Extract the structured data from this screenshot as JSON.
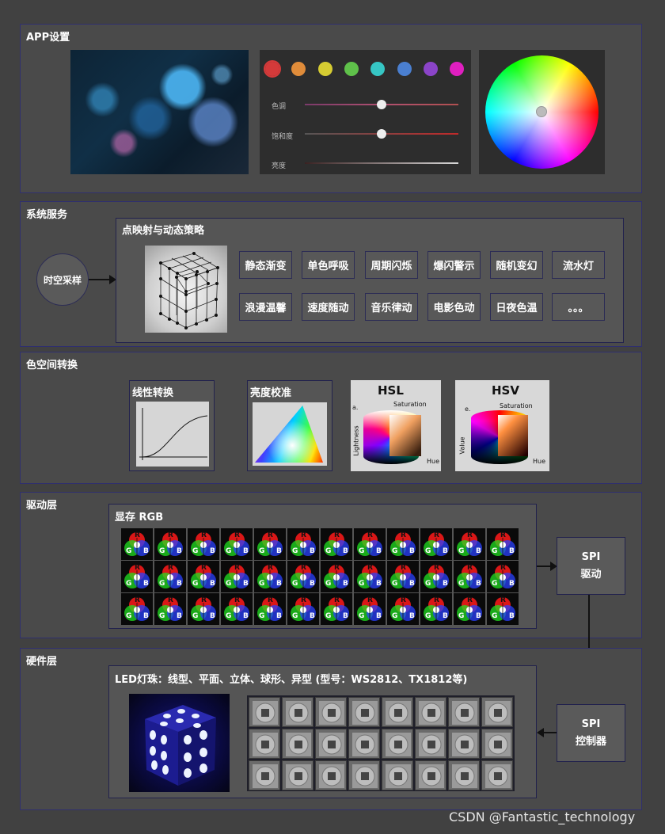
{
  "sections": {
    "app": "APP设置",
    "system": "系统服务",
    "color_space": "色空间转换",
    "driver": "驱动层",
    "hardware": "硬件层"
  },
  "app": {
    "swatches": [
      "#d43a3a",
      "#e08c3a",
      "#d6cc32",
      "#5fc14a",
      "#36c6c4",
      "#4a7fd0",
      "#8b44c8",
      "#e01fc0"
    ],
    "sliders": [
      {
        "label": "色调",
        "value": 0.5
      },
      {
        "label": "饱和度",
        "value": 0.5
      },
      {
        "label": "亮度",
        "value": 1.0
      }
    ]
  },
  "system": {
    "sampling": "时空采样",
    "strategy_title": "点映射与动态策略",
    "effects": [
      "静态渐变",
      "单色呼吸",
      "周期闪烁",
      "爆闪警示",
      "随机变幻",
      "流水灯",
      "浪漫温馨",
      "速度随动",
      "音乐律动",
      "电影色动",
      "日夜色温",
      "。。。"
    ]
  },
  "color_space": {
    "linear": "线性转换",
    "brightness": "亮度校准",
    "hsl_title": "HSL",
    "hsv_title": "HSV",
    "hsl_labels": {
      "panel": "a.",
      "saturation": "Saturation",
      "lightness": "Lightness",
      "hue": "Hue"
    },
    "hsv_labels": {
      "panel": "e.",
      "saturation": "Saturation",
      "value": "Value",
      "hue": "Hue"
    }
  },
  "driver": {
    "vram_title": "显存   RGB",
    "rgb_letters": {
      "r": "R",
      "g": "G",
      "b": "B"
    },
    "spi_driver_line1": "SPI",
    "spi_driver_line2": "驱动"
  },
  "hardware": {
    "led_title": "LED灯珠：线型、平面、立体、球形、异型     (型号：WS2812、TX1812等)",
    "spi_ctrl_line1": "SPI",
    "spi_ctrl_line2": "控制器"
  },
  "watermark": "CSDN @Fantastic_technology"
}
